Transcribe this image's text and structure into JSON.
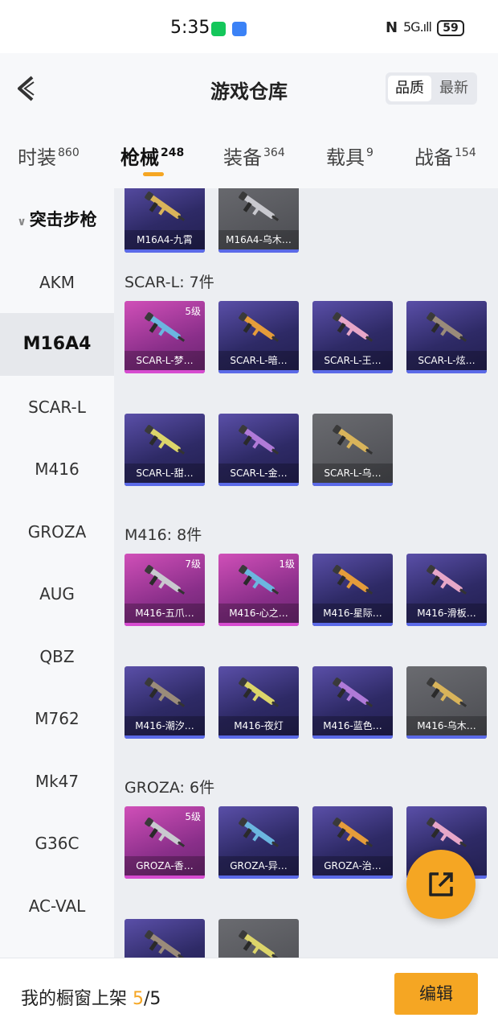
{
  "status_bar": {
    "time": "5:35",
    "nfc": "N",
    "signal": "5G",
    "battery": "59"
  },
  "header": {
    "title": "游戏仓库",
    "sort_options": [
      "品质",
      "最新"
    ],
    "active_sort": "品质"
  },
  "tabs": [
    {
      "label": "时装",
      "count": "860"
    },
    {
      "label": "枪械",
      "count": "248"
    },
    {
      "label": "装备",
      "count": "364"
    },
    {
      "label": "载具",
      "count": "9"
    },
    {
      "label": "战备",
      "count": "154"
    }
  ],
  "active_tab": "枪械",
  "sidebar": {
    "category": "突击步枪",
    "items": [
      "AKM",
      "M16A4",
      "SCAR-L",
      "M416",
      "GROZA",
      "AUG",
      "QBZ",
      "M762",
      "Mk47",
      "G36C",
      "AC-VAL"
    ],
    "active": "M16A4"
  },
  "sections": [
    {
      "title": "",
      "cards": [
        {
          "label": "M16A4-九霄",
          "level": "",
          "rarity": "purple"
        },
        {
          "label": "M16A4-乌木…",
          "level": "",
          "rarity": "gray"
        }
      ]
    },
    {
      "title": "SCAR-L: 7件",
      "cards": [
        {
          "label": "SCAR-L-梦…",
          "level": "5级",
          "rarity": "pink"
        },
        {
          "label": "SCAR-L-暗…",
          "level": "",
          "rarity": "purple"
        },
        {
          "label": "SCAR-L-王…",
          "level": "",
          "rarity": "purple"
        },
        {
          "label": "SCAR-L-炫…",
          "level": "",
          "rarity": "purple"
        },
        {
          "label": "SCAR-L-甜…",
          "level": "",
          "rarity": "purple"
        },
        {
          "label": "SCAR-L-金…",
          "level": "",
          "rarity": "purple"
        },
        {
          "label": "SCAR-L-乌…",
          "level": "",
          "rarity": "gray"
        }
      ]
    },
    {
      "title": "M416: 8件",
      "cards": [
        {
          "label": "M416-五爪…",
          "level": "7级",
          "rarity": "pink"
        },
        {
          "label": "M416-心之…",
          "level": "1级",
          "rarity": "pink"
        },
        {
          "label": "M416-星际…",
          "level": "",
          "rarity": "purple"
        },
        {
          "label": "M416-滑板…",
          "level": "",
          "rarity": "purple"
        },
        {
          "label": "M416-潮汐…",
          "level": "",
          "rarity": "purple"
        },
        {
          "label": "M416-夜灯",
          "level": "",
          "rarity": "purple"
        },
        {
          "label": "M416-蓝色…",
          "level": "",
          "rarity": "purple"
        },
        {
          "label": "M416-乌木…",
          "level": "",
          "rarity": "gray"
        }
      ]
    },
    {
      "title": "GROZA: 6件",
      "cards": [
        {
          "label": "GROZA-香…",
          "level": "5级",
          "rarity": "pink"
        },
        {
          "label": "GROZA-异…",
          "level": "",
          "rarity": "purple"
        },
        {
          "label": "GROZA-治…",
          "level": "",
          "rarity": "purple"
        },
        {
          "label": "",
          "level": "",
          "rarity": "purple"
        },
        {
          "label": "",
          "level": "",
          "rarity": "purple"
        },
        {
          "label": "",
          "level": "",
          "rarity": "gray"
        }
      ]
    }
  ],
  "bottom_bar": {
    "shelf_text": "我的橱窗上架",
    "shelf_count": "5",
    "shelf_total": "/5",
    "edit_label": "编辑"
  },
  "colors": {
    "accent": "#f5a623",
    "purple_card": "#2e2a66",
    "pink_card": "#b03aa8",
    "gray_card": "#55565b"
  }
}
